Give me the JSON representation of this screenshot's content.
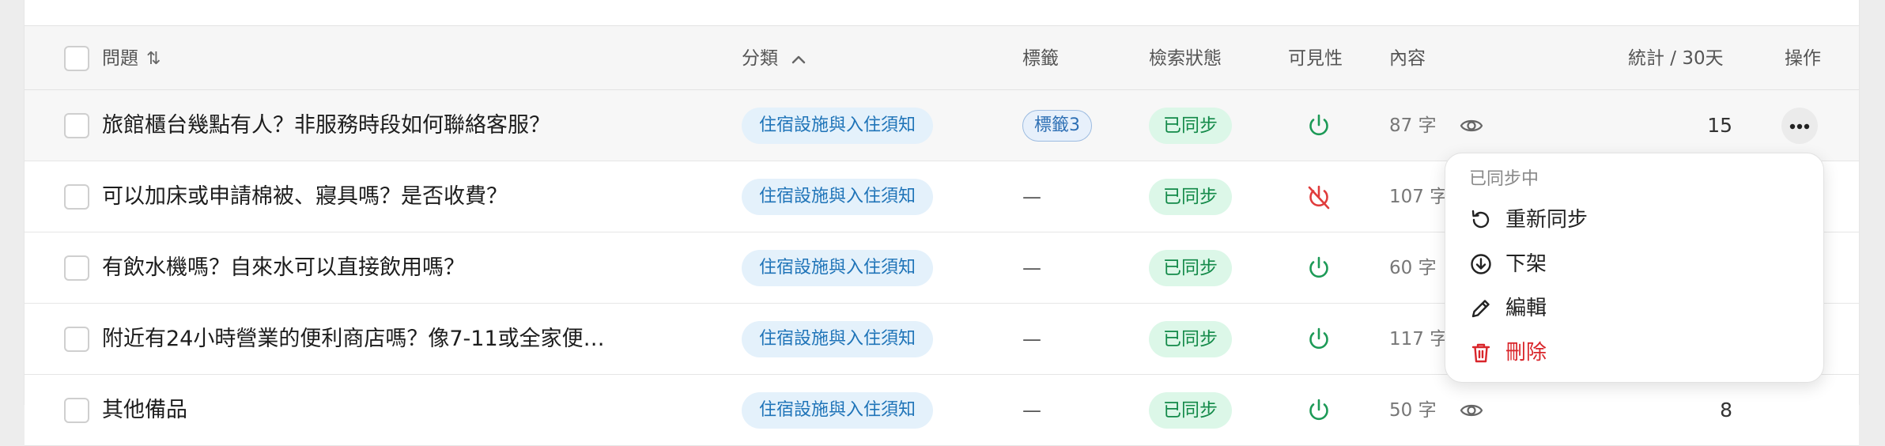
{
  "table": {
    "headers": {
      "question": "問題",
      "category": "分類",
      "tags": "標籤",
      "index_status": "檢索狀態",
      "visibility": "可見性",
      "content": "內容",
      "stats": "統計 / 30天",
      "actions": "操作"
    },
    "rows": [
      {
        "question": "旅館櫃台幾點有人？非服務時段如何聯絡客服？",
        "category": "住宿設施與入住須知",
        "tag": "標籤3",
        "status": "已同步",
        "visibility": "visible",
        "content": "87 字",
        "stat": "15"
      },
      {
        "question": "可以加床或申請棉被、寢具嗎？是否收費？",
        "category": "住宿設施與入住須知",
        "tag": "—",
        "status": "已同步",
        "visibility": "hidden",
        "content": "107 字",
        "stat": ""
      },
      {
        "question": "有飲水機嗎？自來水可以直接飲用嗎？",
        "category": "住宿設施與入住須知",
        "tag": "—",
        "status": "已同步",
        "visibility": "visible",
        "content": "60 字",
        "stat": ""
      },
      {
        "question": "附近有24小時營業的便利商店嗎？像7-11或全家便…",
        "category": "住宿設施與入住須知",
        "tag": "—",
        "status": "已同步",
        "visibility": "visible",
        "content": "117 字",
        "stat": ""
      },
      {
        "question": "其他備品",
        "category": "住宿設施與入住須知",
        "tag": "—",
        "status": "已同步",
        "visibility": "visible",
        "content": "50 字",
        "stat": "8"
      }
    ]
  },
  "menu": {
    "header": "已同步中",
    "items": [
      {
        "label": "重新同步",
        "icon": "refresh-icon"
      },
      {
        "label": "下架",
        "icon": "download-circle-icon"
      },
      {
        "label": "編輯",
        "icon": "pencil-icon"
      },
      {
        "label": "刪除",
        "icon": "trash-icon"
      }
    ]
  },
  "colors": {
    "visible": "#1d9a57",
    "hidden": "#e03c3c",
    "danger": "#d9262b",
    "link": "#1f74b8"
  }
}
